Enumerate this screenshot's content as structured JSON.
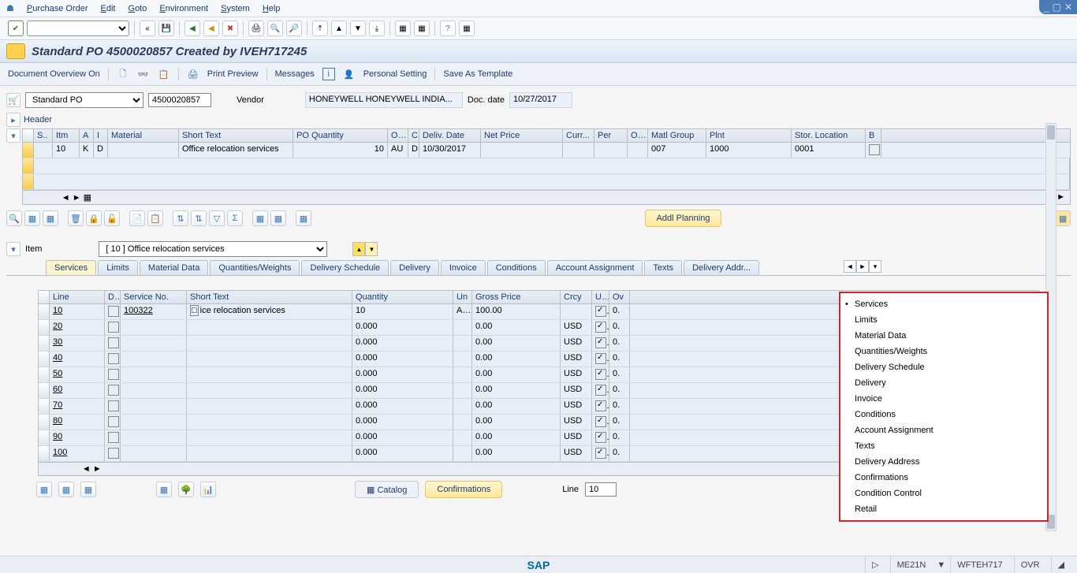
{
  "menubar": {
    "items": [
      "Purchase Order",
      "Edit",
      "Goto",
      "Environment",
      "System",
      "Help"
    ]
  },
  "page_title": "Standard PO 4500020857 Created by IVEH717245",
  "subbar": {
    "doc_overview": "Document Overview On",
    "print_preview": "Print Preview",
    "messages": "Messages",
    "personal": "Personal Setting",
    "save_template": "Save As Template"
  },
  "po_header": {
    "type": "Standard PO",
    "number": "4500020857",
    "vendor_label": "Vendor",
    "vendor_value": "HONEYWELL HONEYWELL INDIA...",
    "docdate_label": "Doc. date",
    "docdate_value": "10/27/2017"
  },
  "header_section_label": "Header",
  "grid_headers": [
    "S..",
    "Itm",
    "A",
    "I",
    "Material",
    "Short Text",
    "PO Quantity",
    "O...",
    "C",
    "Deliv. Date",
    "Net Price",
    "Curr...",
    "Per",
    "O...",
    "Matl Group",
    "Plnt",
    "Stor. Location",
    "B"
  ],
  "grid_row": {
    "itm": "10",
    "a": "K",
    "i": "D",
    "material": "",
    "short_text": "Office relocation services",
    "qty": "10",
    "oun": "AU",
    "c": "D",
    "deliv": "10/30/2017",
    "net": "",
    "curr": "",
    "per": "",
    "o2": "",
    "matl": "007",
    "plnt": "1000",
    "stor": "0001"
  },
  "addl_planning": "Addl Planning",
  "item_section": {
    "label": "Item",
    "dropdown": "[ 10 ] Office relocation services"
  },
  "tabs": [
    "Services",
    "Limits",
    "Material Data",
    "Quantities/Weights",
    "Delivery Schedule",
    "Delivery",
    "Invoice",
    "Conditions",
    "Account Assignment",
    "Texts",
    "Delivery Addr..."
  ],
  "svc_headers": [
    "Line",
    "D..",
    "Service No.",
    "Short Text",
    "Quantity",
    "Un",
    "Gross Price",
    "Crcy",
    "U..",
    "Ov"
  ],
  "svc_rows": [
    {
      "line": "10",
      "d": false,
      "sno": "100322",
      "st": "ice relocation services",
      "qty": "10",
      "un": "AU",
      "gp": "100.00",
      "crcy": "",
      "u": true,
      "ov": "0."
    },
    {
      "line": "20",
      "d": false,
      "sno": "",
      "st": "",
      "qty": "0.000",
      "un": "",
      "gp": "0.00",
      "crcy": "USD",
      "u": true,
      "ov": "0."
    },
    {
      "line": "30",
      "d": false,
      "sno": "",
      "st": "",
      "qty": "0.000",
      "un": "",
      "gp": "0.00",
      "crcy": "USD",
      "u": true,
      "ov": "0."
    },
    {
      "line": "40",
      "d": false,
      "sno": "",
      "st": "",
      "qty": "0.000",
      "un": "",
      "gp": "0.00",
      "crcy": "USD",
      "u": true,
      "ov": "0."
    },
    {
      "line": "50",
      "d": false,
      "sno": "",
      "st": "",
      "qty": "0.000",
      "un": "",
      "gp": "0.00",
      "crcy": "USD",
      "u": true,
      "ov": "0."
    },
    {
      "line": "60",
      "d": false,
      "sno": "",
      "st": "",
      "qty": "0.000",
      "un": "",
      "gp": "0.00",
      "crcy": "USD",
      "u": true,
      "ov": "0."
    },
    {
      "line": "70",
      "d": false,
      "sno": "",
      "st": "",
      "qty": "0.000",
      "un": "",
      "gp": "0.00",
      "crcy": "USD",
      "u": true,
      "ov": "0."
    },
    {
      "line": "80",
      "d": false,
      "sno": "",
      "st": "",
      "qty": "0.000",
      "un": "",
      "gp": "0.00",
      "crcy": "USD",
      "u": true,
      "ov": "0."
    },
    {
      "line": "90",
      "d": false,
      "sno": "",
      "st": "",
      "qty": "0.000",
      "un": "",
      "gp": "0.00",
      "crcy": "USD",
      "u": true,
      "ov": "0."
    },
    {
      "line": "100",
      "d": false,
      "sno": "",
      "st": "",
      "qty": "0.000",
      "un": "",
      "gp": "0.00",
      "crcy": "USD",
      "u": true,
      "ov": "0."
    }
  ],
  "catalog": "Catalog",
  "confirmations_btn": "Confirmations",
  "line_label": "Line",
  "line_value": "10",
  "popup": [
    "Services",
    "Limits",
    "Material Data",
    "Quantities/Weights",
    "Delivery Schedule",
    "Delivery",
    "Invoice",
    "Conditions",
    "Account Assignment",
    "Texts",
    "Delivery Address",
    "Confirmations",
    "Condition Control",
    "Retail"
  ],
  "status": {
    "tcode": "ME21N",
    "sep": "▼",
    "user": "WFTEH717",
    "mode": "OVR"
  }
}
